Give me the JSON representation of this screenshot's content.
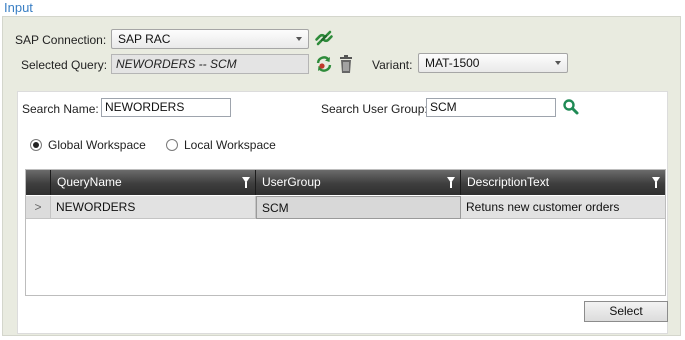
{
  "section": {
    "title": "Input"
  },
  "connection": {
    "label": "SAP Connection:",
    "value": "SAP RAC"
  },
  "query": {
    "label": "Selected Query:",
    "value": "NEWORDERS -- SCM"
  },
  "variant": {
    "label": "Variant:",
    "value": "MAT-1500"
  },
  "search": {
    "name_label": "Search Name:",
    "name_value": "NEWORDERS",
    "group_label": "Search User Group:",
    "group_value": "SCM"
  },
  "workspace": {
    "global_label": "Global Workspace",
    "local_label": "Local Workspace",
    "selected": "global"
  },
  "grid": {
    "columns": [
      "QueryName",
      "UserGroup",
      "DescriptionText"
    ],
    "rows": [
      {
        "indicator": ">",
        "cells": [
          "NEWORDERS",
          "SCM",
          "Retuns new customer orders"
        ]
      }
    ]
  },
  "actions": {
    "select_label": "Select"
  },
  "colors": {
    "accent": "#3a7fc4",
    "panel": "#e9ebe0",
    "icon_green": "#2e8b3a"
  }
}
